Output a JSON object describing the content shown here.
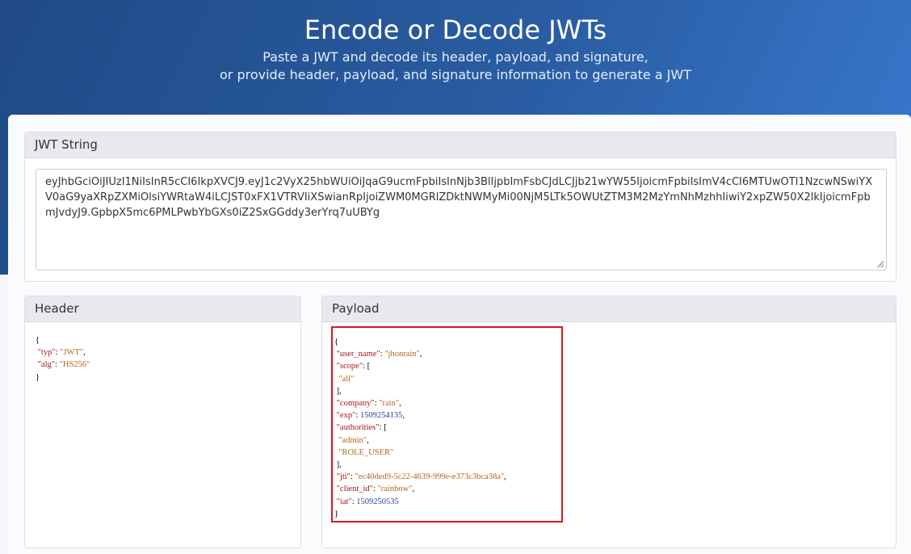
{
  "hero": {
    "title": "Encode or Decode JWTs",
    "subtitle_line1": "Paste a JWT and decode its header, payload, and signature,",
    "subtitle_line2": "or provide header, payload, and signature information to generate a JWT"
  },
  "jwt_panel": {
    "title": "JWT String",
    "value": "eyJhbGciOiJIUzI1NiIsInR5cCI6IkpXVCJ9.eyJ1c2VyX25hbWUiOiJqaG9ucmFpbiIsInNjb3BlIjpbImFsbCJdLCJjb21wYW55IjoicmFpbiIsImV4cCI6MTUwOTI1NzcwNSwiYXV0aG9yaXRpZXMiOlsiYWRtaW4iLCJST0xFX1VTRVIiXSwianRpIjoiZWM0MGRlZDktNWMyMi00NjM5LTk5OWUtZTM3M2MzYmNhMzhhIiwiY2xpZW50X2lkIjoicmFpbmJvdyJ9.GpbpX5mc6PMLPwbYbGXs0iZ2SxGGddy3erYrq7uUBYg"
  },
  "header_panel": {
    "title": "Header",
    "typ_key": "\"typ\"",
    "typ_val": "\"JWT\"",
    "alg_key": "\"alg\"",
    "alg_val": "\"HS256\""
  },
  "payload_panel": {
    "title": "Payload",
    "user_name_key": "\"user_name\"",
    "user_name_val": "\"jhonrain\"",
    "scope_key": "\"scope\"",
    "scope_item": "\"all\"",
    "company_key": "\"company\"",
    "company_val": "\"rain\"",
    "exp_key": "\"exp\"",
    "exp_val": "1509254135",
    "authorities_key": "\"authorities\"",
    "authority_1": "\"admin\"",
    "authority_2": "\"ROLE_USER\"",
    "jti_key": "\"jti\"",
    "jti_val": "\"ec40ded9-5c22-4639-999e-e373c3bca38a\"",
    "client_id_key": "\"client_id\"",
    "client_id_val": "\"rainbow\"",
    "iat_key": "\"iat\"",
    "iat_val": "1509250535"
  },
  "colors": {
    "hero_start": "#1f4a86",
    "hero_end": "#3a7ad0",
    "highlight_border": "#d8191f",
    "json_key": "#a3151a",
    "json_string": "#b5641a",
    "json_number": "#2a3fa0"
  }
}
